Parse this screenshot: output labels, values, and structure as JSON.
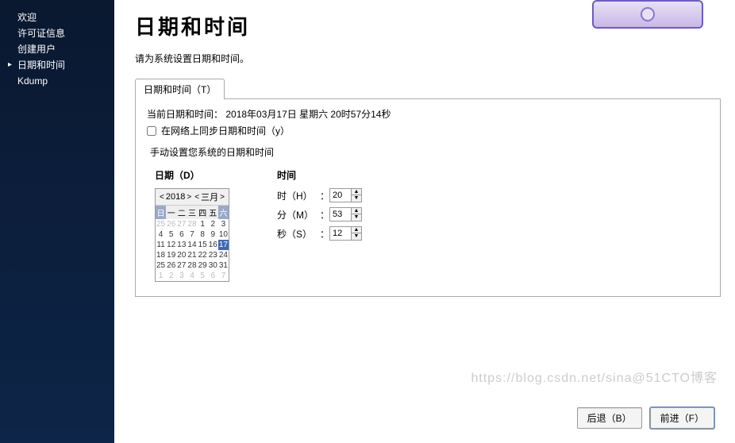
{
  "sidebar": {
    "items": [
      {
        "label": "欢迎"
      },
      {
        "label": "许可证信息"
      },
      {
        "label": "创建用户"
      },
      {
        "label": "日期和时间",
        "active": true
      },
      {
        "label": "Kdump"
      }
    ]
  },
  "header": {
    "title": "日期和时间",
    "instruction": "请为系统设置日期和时间。"
  },
  "tab": {
    "label": "日期和时间（T）"
  },
  "panel": {
    "current_dt_label": "当前日期和时间：",
    "current_dt_value": "2018年03月17日 星期六 20时57分14秒",
    "sync_checkbox_label": "在网络上同步日期和时间（y）",
    "sync_checked": false,
    "manual_label": "手动设置您系统的日期和时间"
  },
  "date": {
    "col_title": "日期（D）",
    "year": "2018",
    "month": "三月",
    "dow": [
      "日",
      "一",
      "二",
      "三",
      "四",
      "五",
      "六"
    ],
    "days": [
      {
        "n": 25,
        "other": true
      },
      {
        "n": 26,
        "other": true
      },
      {
        "n": 27,
        "other": true
      },
      {
        "n": 28,
        "other": true
      },
      {
        "n": 1
      },
      {
        "n": 2
      },
      {
        "n": 3
      },
      {
        "n": 4
      },
      {
        "n": 5
      },
      {
        "n": 6
      },
      {
        "n": 7
      },
      {
        "n": 8
      },
      {
        "n": 9
      },
      {
        "n": 10
      },
      {
        "n": 11
      },
      {
        "n": 12
      },
      {
        "n": 13
      },
      {
        "n": 14
      },
      {
        "n": 15
      },
      {
        "n": 16
      },
      {
        "n": 17,
        "selected": true
      },
      {
        "n": 18
      },
      {
        "n": 19
      },
      {
        "n": 20
      },
      {
        "n": 21
      },
      {
        "n": 22
      },
      {
        "n": 23
      },
      {
        "n": 24
      },
      {
        "n": 25
      },
      {
        "n": 26
      },
      {
        "n": 27
      },
      {
        "n": 28
      },
      {
        "n": 29
      },
      {
        "n": 30
      },
      {
        "n": 31
      },
      {
        "n": 1,
        "other": true
      },
      {
        "n": 2,
        "other": true
      },
      {
        "n": 3,
        "other": true
      },
      {
        "n": 4,
        "other": true
      },
      {
        "n": 5,
        "other": true
      },
      {
        "n": 6,
        "other": true
      },
      {
        "n": 7,
        "other": true
      }
    ]
  },
  "time": {
    "col_title": "时间",
    "hour_label": "时（H）",
    "minute_label": "分（M）",
    "second_label": "秒（S）",
    "hour": "20",
    "minute": "53",
    "second": "12"
  },
  "footer": {
    "back": "后退（B）",
    "forward": "前进（F）"
  },
  "watermark": "https://blog.csdn.net/sina@51CTO博客"
}
